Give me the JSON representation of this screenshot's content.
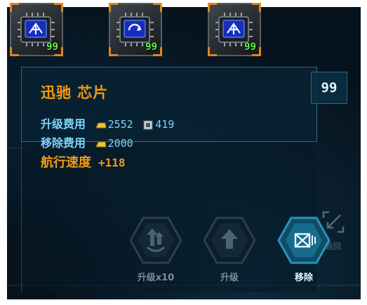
{
  "slots": [
    {
      "icon": "chip-icon",
      "count": "99"
    },
    {
      "icon": "chip-icon",
      "count": "99"
    },
    {
      "icon": "chip-icon",
      "count": "99"
    }
  ],
  "detail": {
    "level": "99",
    "title": "迅驰 芯片",
    "upgrade_cost_label": "升级费用",
    "upgrade_gold": "2552",
    "upgrade_parts": "419",
    "remove_cost_label": "移除费用",
    "remove_gold": "2000",
    "stat_label": "航行速度",
    "stat_value": "+118"
  },
  "actions": {
    "upgrade10_label": "升级x10",
    "upgrade_label": "升级",
    "remove_label": "移除",
    "back_label": "返回"
  },
  "colors": {
    "accent_orange": "#f29a12",
    "info_blue": "#7fd2f5",
    "count_green": "#62f24a",
    "remove_button": "#2a93bd"
  }
}
